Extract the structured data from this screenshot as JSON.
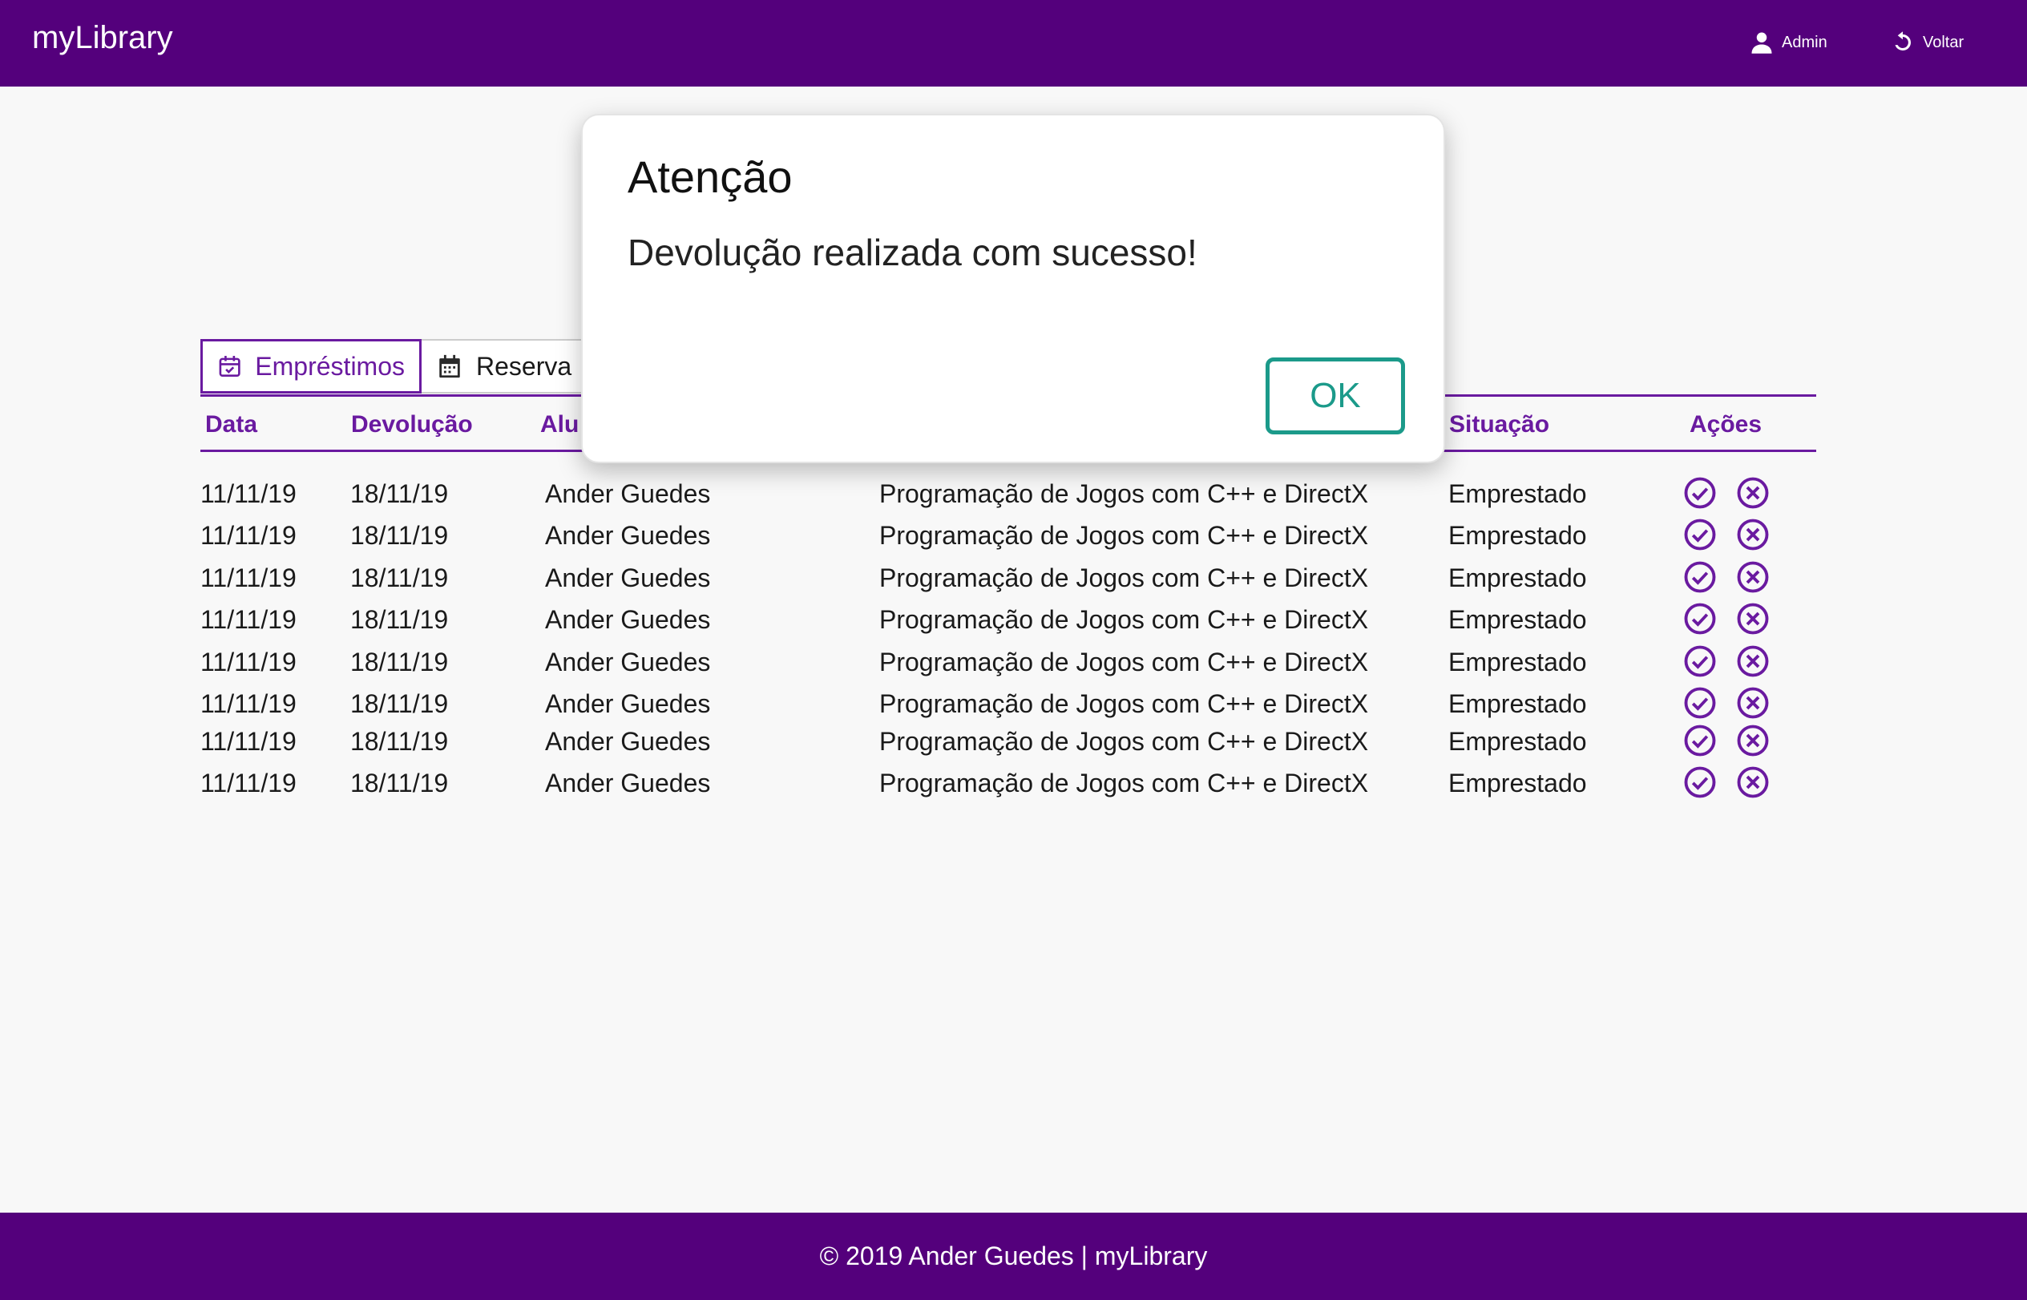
{
  "header": {
    "brand": "myLibrary",
    "admin_label": "Admin",
    "back_label": "Voltar"
  },
  "tabs": [
    {
      "label": "Empréstimos",
      "icon": "calendar-check-icon",
      "active": true
    },
    {
      "label": "Reserva",
      "icon": "calendar-icon",
      "active": false
    }
  ],
  "table": {
    "columns": [
      "Data",
      "Devolução",
      "Alu",
      "Situação",
      "Ações"
    ],
    "rows": [
      [
        "11/11/19",
        "18/11/19",
        "Ander Guedes",
        "Programação de Jogos com C++ e DirectX",
        "Emprestado"
      ],
      [
        "11/11/19",
        "18/11/19",
        "Ander Guedes",
        "Programação de Jogos com C++ e DirectX",
        "Emprestado"
      ],
      [
        "11/11/19",
        "18/11/19",
        "Ander Guedes",
        "Programação de Jogos com C++ e DirectX",
        "Emprestado"
      ],
      [
        "11/11/19",
        "18/11/19",
        "Ander Guedes",
        "Programação de Jogos com C++ e DirectX",
        "Emprestado"
      ],
      [
        "11/11/19",
        "18/11/19",
        "Ander Guedes",
        "Programação de Jogos com C++ e DirectX",
        "Emprestado"
      ],
      [
        "11/11/19",
        "18/11/19",
        "Ander Guedes",
        "Programação de Jogos com C++ e DirectX",
        "Emprestado"
      ],
      [
        "11/11/19",
        "18/11/19",
        "Ander Guedes",
        "Programação de Jogos com C++ e DirectX",
        "Emprestado"
      ],
      [
        "11/11/19",
        "18/11/19",
        "Ander Guedes",
        "Programação de Jogos com C++ e DirectX",
        "Emprestado"
      ]
    ]
  },
  "modal": {
    "title": "Atenção",
    "message": "Devolução realizada com sucesso!",
    "ok_label": "OK"
  },
  "footer": {
    "text": "© 2019 Ander Guedes | myLibrary"
  },
  "colors": {
    "primary": "#54007c",
    "accent": "#6a1aa0",
    "ok": "#1b9a8a"
  }
}
